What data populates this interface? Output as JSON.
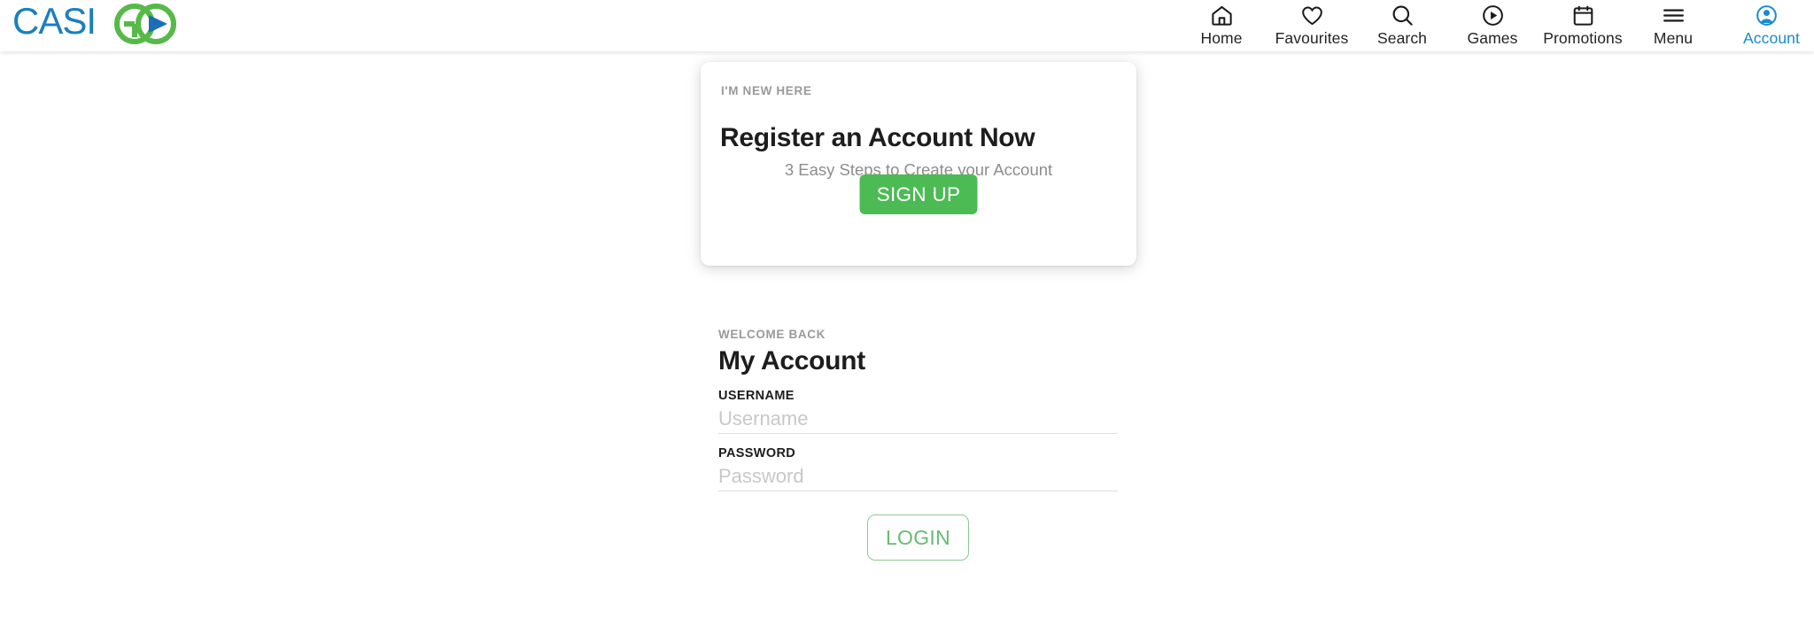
{
  "brand": {
    "name": "CASIGO",
    "text_primary": "CASI",
    "text_secondary": "GO",
    "color_blue": "#1b7fbd",
    "color_green": "#56b948",
    "color_play": "#1a6fb5"
  },
  "nav": {
    "items": [
      {
        "label": "Home",
        "icon": "home-icon",
        "active": false
      },
      {
        "label": "Favourites",
        "icon": "heart-icon",
        "active": false
      },
      {
        "label": "Search",
        "icon": "search-icon",
        "active": false
      },
      {
        "label": "Games",
        "icon": "play-circle-icon",
        "active": false
      },
      {
        "label": "Promotions",
        "icon": "calendar-icon",
        "active": false
      },
      {
        "label": "Menu",
        "icon": "hamburger-icon",
        "active": false
      },
      {
        "label": "Account",
        "icon": "account-icon",
        "active": true
      }
    ],
    "active_color": "#1b8bd0",
    "label_color": "#232323"
  },
  "register_card": {
    "eyebrow": "I'M NEW HERE",
    "title": "Register an Account Now",
    "subtitle": "3 Easy Steps to Create your Account",
    "signup_label": "SIGN UP",
    "signup_color": "#4cbb54"
  },
  "login": {
    "eyebrow": "WELCOME BACK",
    "title": "My Account",
    "username_label": "USERNAME",
    "username_placeholder": "Username",
    "username_value": "",
    "password_label": "PASSWORD",
    "password_placeholder": "Password",
    "password_value": "",
    "login_label": "LOGIN",
    "login_border_color": "#8ec995",
    "login_text_color": "#68ba73"
  }
}
